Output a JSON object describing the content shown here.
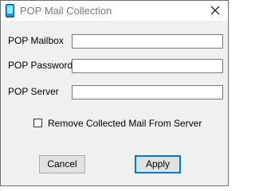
{
  "window": {
    "title": "POP Mail Collection"
  },
  "form": {
    "mailbox_label": "POP Mailbox",
    "mailbox_value": "",
    "password_label": "POP Password",
    "password_value": "",
    "server_label": "POP Server",
    "server_value": "",
    "remove_checkbox_label": "Remove Collected Mail From Server",
    "remove_checked": false
  },
  "buttons": {
    "cancel_label": "Cancel",
    "apply_label": "Apply"
  },
  "colors": {
    "title_text": "#7a7a7a",
    "dialog_bg": "#f0f0f0",
    "default_button_border": "#0078d7"
  },
  "icons": {
    "app": "mobile-device-icon",
    "close": "close-icon"
  }
}
